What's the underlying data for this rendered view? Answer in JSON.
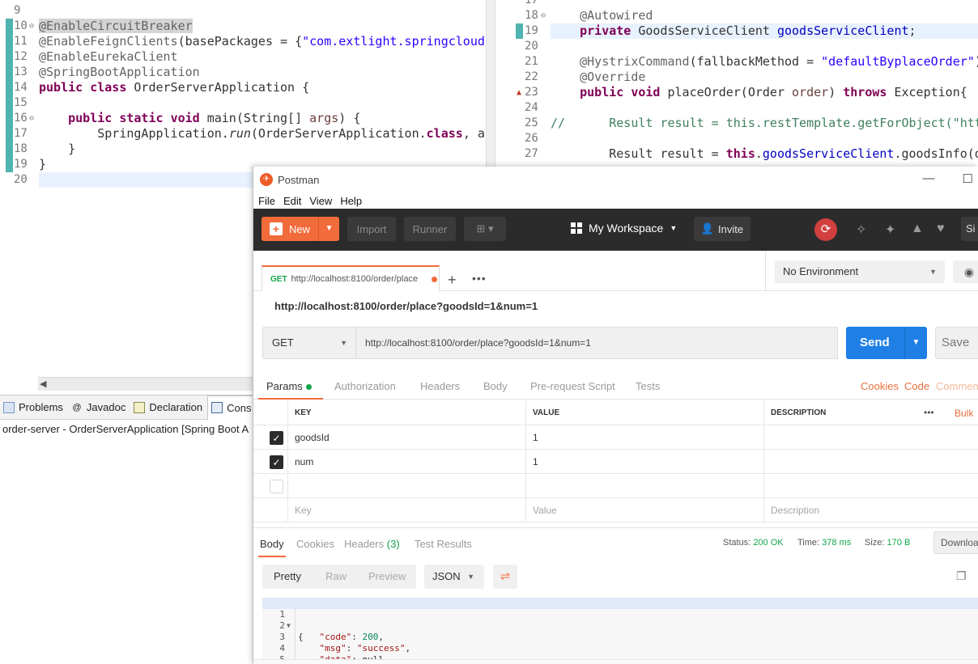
{
  "eclipse_left": {
    "lines": [
      {
        "n": "9",
        "parts": []
      },
      {
        "n": "10",
        "parts": [
          [
            "ann sel-ann",
            "@EnableCircuitBreaker"
          ]
        ]
      },
      {
        "n": "11",
        "parts": [
          [
            "ann",
            "@EnableFeignClients"
          ],
          [
            "",
            "(basePackages = {"
          ],
          [
            "str",
            "\"com.extlight.springcloud"
          ]
        ]
      },
      {
        "n": "12",
        "parts": [
          [
            "ann",
            "@EnableEurekaClient"
          ]
        ]
      },
      {
        "n": "13",
        "parts": [
          [
            "ann",
            "@SpringBootApplication"
          ]
        ]
      },
      {
        "n": "14",
        "parts": [
          [
            "kw",
            "public"
          ],
          [
            "",
            " "
          ],
          [
            "kw",
            "class"
          ],
          [
            "",
            " OrderServerApplication {"
          ]
        ]
      },
      {
        "n": "15",
        "parts": []
      },
      {
        "n": "16",
        "parts": [
          [
            "",
            "    "
          ],
          [
            "kw",
            "public"
          ],
          [
            "",
            " "
          ],
          [
            "kw",
            "static"
          ],
          [
            "",
            " "
          ],
          [
            "kw",
            "void"
          ],
          [
            "",
            " main(String[] "
          ],
          [
            "prm",
            "args"
          ],
          [
            "",
            ") {"
          ]
        ]
      },
      {
        "n": "17",
        "parts": [
          [
            "",
            "        SpringApplication."
          ],
          [
            "it",
            "run"
          ],
          [
            "",
            "(OrderServerApplication."
          ],
          [
            "kw",
            "class"
          ],
          [
            "",
            ", a"
          ]
        ]
      },
      {
        "n": "18",
        "parts": [
          [
            "",
            "    }"
          ]
        ]
      },
      {
        "n": "19",
        "parts": [
          [
            "",
            "}"
          ]
        ]
      },
      {
        "n": "20",
        "parts": []
      }
    ]
  },
  "eclipse_right": {
    "lines": [
      {
        "n": "17",
        "parts": []
      },
      {
        "n": "18",
        "parts": [
          [
            "",
            "    "
          ],
          [
            "ann",
            "@Autowired"
          ]
        ]
      },
      {
        "n": "19",
        "parts": [
          [
            "",
            "    "
          ],
          [
            "kw",
            "private"
          ],
          [
            "",
            " GoodsServiceClient "
          ],
          [
            "fld",
            "goodsServiceClient"
          ],
          [
            "",
            ";"
          ]
        ]
      },
      {
        "n": "20",
        "parts": []
      },
      {
        "n": "21",
        "parts": [
          [
            "",
            "    "
          ],
          [
            "ann",
            "@HystrixCommand"
          ],
          [
            "",
            "(fallbackMethod = "
          ],
          [
            "str",
            "\"defaultByplaceOrder\""
          ],
          [
            "",
            ")"
          ]
        ]
      },
      {
        "n": "22",
        "parts": [
          [
            "",
            "    "
          ],
          [
            "ann",
            "@Override"
          ]
        ]
      },
      {
        "n": "23",
        "parts": [
          [
            "",
            "    "
          ],
          [
            "kw",
            "public"
          ],
          [
            "",
            " "
          ],
          [
            "kw",
            "void"
          ],
          [
            "",
            " placeOrder(Order "
          ],
          [
            "prm",
            "order"
          ],
          [
            "",
            ") "
          ],
          [
            "kw",
            "throws"
          ],
          [
            "",
            " Exception{"
          ]
        ]
      },
      {
        "n": "24",
        "parts": []
      },
      {
        "n": "25",
        "parts": [
          [
            "cmt",
            "//      Result result = this.restTemplate.getForObject(\"htt"
          ]
        ]
      },
      {
        "n": "26",
        "parts": []
      },
      {
        "n": "27",
        "parts": [
          [
            "",
            "        Result result = "
          ],
          [
            "kw",
            "this"
          ],
          [
            "",
            "."
          ],
          [
            "fld",
            "goodsServiceClient"
          ],
          [
            "",
            ".goodsInfo(o"
          ]
        ]
      }
    ]
  },
  "views": {
    "tabs": [
      "Problems",
      "Javadoc",
      "Declaration",
      "Cons"
    ],
    "console_title": "order-server - OrderServerApplication [Spring Boot A"
  },
  "postman": {
    "title": "Postman",
    "menu": [
      "File",
      "Edit",
      "View",
      "Help"
    ],
    "header": {
      "new": "New",
      "import": "Import",
      "runner": "Runner",
      "workspace": "My Workspace",
      "invite": "Invite",
      "sign": "Si"
    },
    "tab": {
      "method": "GET",
      "url": "http://localhost:8100/order/place"
    },
    "environment": "No Environment",
    "url_title": "http://localhost:8100/order/place?goodsId=1&num=1",
    "method": "GET",
    "url": "http://localhost:8100/order/place?goodsId=1&num=1",
    "send": "Send",
    "save": "Save",
    "request_tabs": {
      "params": "Params",
      "authorization": "Authorization",
      "headers": "Headers",
      "body": "Body",
      "prerequest": "Pre-request Script",
      "tests": "Tests",
      "cookies": "Cookies",
      "code": "Code",
      "comments": "Commen"
    },
    "params_table": {
      "headers": {
        "key": "KEY",
        "value": "VALUE",
        "description": "DESCRIPTION",
        "bulk": "Bulk"
      },
      "rows": [
        {
          "key": "goodsId",
          "value": "1"
        },
        {
          "key": "num",
          "value": "1"
        }
      ],
      "placeholders": {
        "key": "Key",
        "value": "Value",
        "description": "Description"
      }
    },
    "response_tabs": {
      "body": "Body",
      "cookies": "Cookies",
      "headers": "Headers",
      "headers_count": "(3)",
      "test_results": "Test Results"
    },
    "status": {
      "status_label": "Status:",
      "status_value": "200 OK",
      "time_label": "Time:",
      "time_value": "378 ms",
      "size_label": "Size:",
      "size_value": "170 B",
      "download": "Downloa"
    },
    "format": {
      "pretty": "Pretty",
      "raw": "Raw",
      "preview": "Preview",
      "type": "JSON"
    },
    "response_lines": [
      {
        "n": "1",
        "text": "{"
      },
      {
        "n": "2",
        "key": "\"code\"",
        "val": "200",
        "vt": "num",
        "end": ","
      },
      {
        "n": "3",
        "key": "\"msg\"",
        "val": "\"success\"",
        "vt": "str",
        "end": ","
      },
      {
        "n": "4",
        "key": "\"data\"",
        "val": "null",
        "vt": "plain",
        "end": ""
      },
      {
        "n": "5",
        "text": "}"
      }
    ]
  }
}
